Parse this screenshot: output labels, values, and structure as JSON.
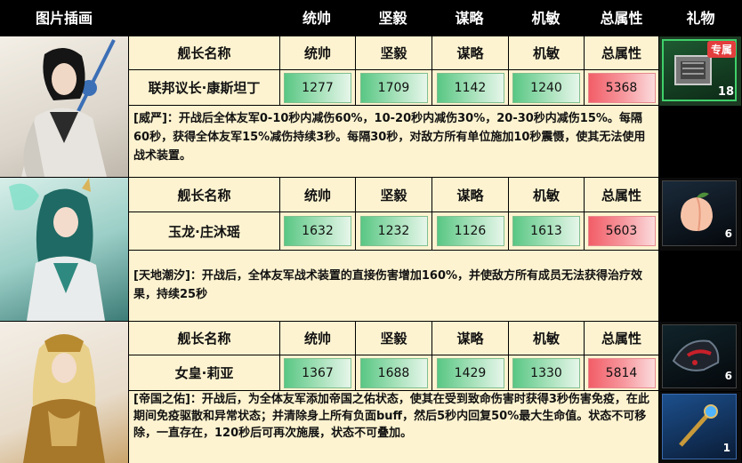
{
  "header": {
    "image_col": "图片插画",
    "tong_shuai": "统帅",
    "jian_yi": "坚毅",
    "mou_lue": "谋略",
    "ji_min": "机敏",
    "total": "总属性",
    "gift": "礼物"
  },
  "labels": {
    "name_col": "舰长名称",
    "tong_shuai": "统帅",
    "jian_yi": "坚毅",
    "mou_lue": "谋略",
    "ji_min": "机敏",
    "total": "总属性"
  },
  "captains": [
    {
      "name": "联邦议长·康斯坦丁",
      "tong_shuai": "1277",
      "jian_yi": "1709",
      "mou_lue": "1142",
      "ji_min": "1240",
      "total": "5368",
      "skill": "[威严]：开战后全体友军0-10秒内减伤60%，10-20秒内减伤30%，20-30秒内减伤15%。每隔60秒，获得全体友军15%减伤持续3秒。每隔30秒，对敌方所有单位施加10秒震慑，使其无法使用战术装置。",
      "gifts": [
        {
          "icon": "exclusive-chest-icon",
          "tag": "专属",
          "count": "18"
        }
      ]
    },
    {
      "name": "玉龙·庄沐瑶",
      "tong_shuai": "1632",
      "jian_yi": "1232",
      "mou_lue": "1126",
      "ji_min": "1613",
      "total": "5603",
      "skill": "[天地潮汐]：开战后，全体友军战术装置的直接伤害增加160%，并使敌方所有成员无法获得治疗效果，持续25秒",
      "gifts": [
        {
          "icon": "peach-icon",
          "count": "6"
        }
      ]
    },
    {
      "name": "女皇·莉亚",
      "tong_shuai": "1367",
      "jian_yi": "1688",
      "mou_lue": "1429",
      "ji_min": "1330",
      "total": "5814",
      "skill": "[帝国之佑]：开战后，为全体友军添加帝国之佑状态，使其在受到致命伤害时获得3秒伤害免疫，在此期间免疫驱散和异常状态；并清除身上所有负面buff，然后5秒内回复50%最大生命值。状态不可移除，一直存在，120秒后可再次施展，状态不可叠加。",
      "gifts": [
        {
          "icon": "crown-helmet-icon",
          "count": "6"
        },
        {
          "icon": "scepter-icon",
          "count": "1"
        }
      ]
    }
  ]
}
